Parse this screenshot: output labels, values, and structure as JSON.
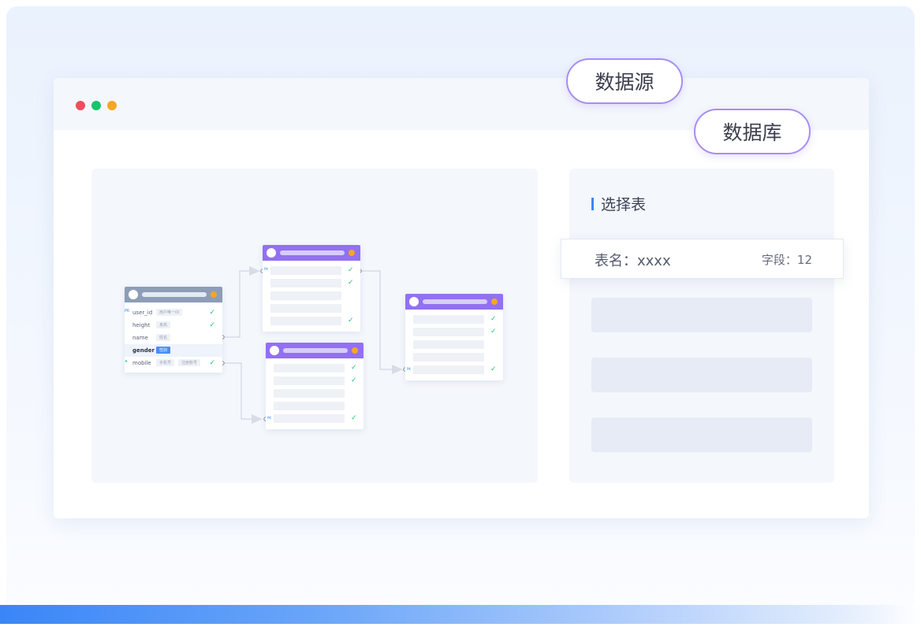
{
  "badges": {
    "datasource": "数据源",
    "database": "数据库"
  },
  "window": {
    "dots": [
      "#ef4d5c",
      "#19c46b",
      "#f5a623"
    ]
  },
  "right_panel": {
    "section_title": "选择表",
    "selected_table": {
      "name": "表名：xxxx",
      "field_count": "字段：12"
    }
  },
  "diagram": {
    "source_table": {
      "rows": [
        {
          "pk": "PK",
          "field": "user_id",
          "tag": "用户唯一ID"
        },
        {
          "field": "height",
          "tag": "身高"
        },
        {
          "field": "name",
          "tag": "姓名"
        },
        {
          "field": "gender",
          "tag": "性别"
        },
        {
          "field": "mobile",
          "tag": "手机号",
          "tag2": "注册账号"
        }
      ]
    },
    "link_badge": "PK"
  }
}
